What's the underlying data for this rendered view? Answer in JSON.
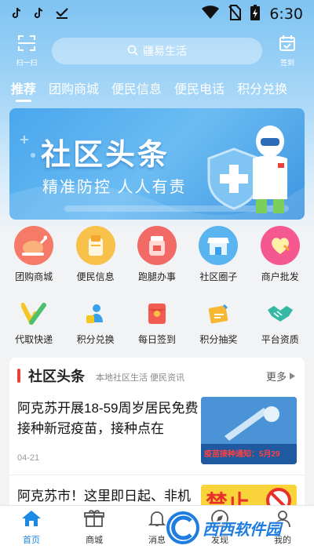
{
  "status_bar": {
    "time": "6:30",
    "left_icons": [
      "tiktok-icon",
      "tiktok-icon",
      "download-done-icon"
    ],
    "right_icons": [
      "wifi-icon",
      "no-sim-icon",
      "battery-charging-icon"
    ]
  },
  "header": {
    "scan_label": "扫一扫",
    "search_placeholder": "疆易生活",
    "checkin_label": "签到"
  },
  "tabs": [
    {
      "label": "推荐",
      "active": true
    },
    {
      "label": "团购商城"
    },
    {
      "label": "便民信息"
    },
    {
      "label": "便民电话"
    },
    {
      "label": "积分兑换"
    }
  ],
  "banner": {
    "title": "社区头条",
    "subtitle": "精准防控 人人有责"
  },
  "grid1": [
    {
      "label": "团购商城",
      "icon": "roast-chicken-icon",
      "color": "#f0614f"
    },
    {
      "label": "便民信息",
      "icon": "bread-icon",
      "color": "#f6b733"
    },
    {
      "label": "跑腿办事",
      "icon": "jar-icon",
      "color": "#ef5b57"
    },
    {
      "label": "社区圈子",
      "icon": "store-icon",
      "color": "#3aa0ea"
    },
    {
      "label": "商户批发",
      "icon": "heart-pin-icon",
      "color": "#f04f8a"
    }
  ],
  "grid2": [
    {
      "label": "代取快递",
      "icon": "v-check-icon"
    },
    {
      "label": "积分兑换",
      "icon": "exchange-person-icon"
    },
    {
      "label": "每日签到",
      "icon": "red-envelope-icon"
    },
    {
      "label": "积分抽奖",
      "icon": "lottery-ticket-icon"
    },
    {
      "label": "平台资质",
      "icon": "handshake-icon"
    }
  ],
  "news": {
    "title": "社区头条",
    "subtitle": "本地社区生活 便民资讯",
    "more": "更多",
    "articles": [
      {
        "text": "阿克苏开展18-59周岁居民免费接种新冠疫苗，接种点在",
        "date": "04-21",
        "thumb_caption": "疫苗接种通知：5月29"
      },
      {
        "text": "阿克苏市！这里即日起、非机",
        "date": "",
        "thumb_caption": "禁止"
      }
    ]
  },
  "bottom_nav": [
    {
      "label": "首页",
      "icon": "home-icon",
      "active": true
    },
    {
      "label": "商城",
      "icon": "gift-icon"
    },
    {
      "label": "消息",
      "icon": "bell-icon"
    },
    {
      "label": "发现",
      "icon": "compass-icon"
    },
    {
      "label": "我的",
      "icon": "user-icon"
    }
  ],
  "watermark": {
    "text": "西西软件园"
  },
  "colors": {
    "accent": "#1e88e5",
    "headline_bar": "#e8413c",
    "top_gradient": "#7ec3f2"
  }
}
